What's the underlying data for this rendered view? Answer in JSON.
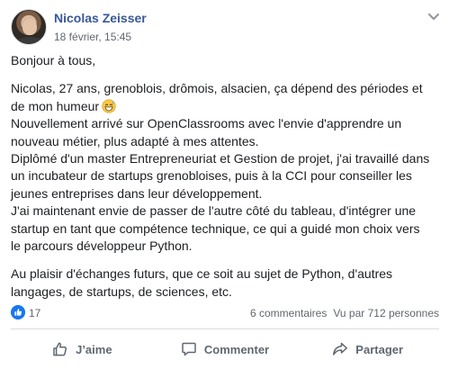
{
  "post": {
    "author": "Nicolas Zeisser",
    "timestamp": "18 février, 15:45",
    "paragraphs": [
      [
        "Bonjour à tous,"
      ],
      [
        "Nicolas, 27 ans, grenoblois, drômois, alsacien, ça dépend des périodes et",
        "de mon humeur",
        "Nouvellement arrivé sur OpenClassrooms avec l'envie d'apprendre un",
        "nouveau métier, plus adapté à mes attentes.",
        "Diplômé d'un master Entrepreneuriat et Gestion de projet, j'ai travaillé dans",
        "un incubateur de startups grenobloises, puis à la CCI pour conseiller les",
        "jeunes entreprises dans leur développement.",
        "J'ai maintenant envie de passer de l'autre côté du tableau, d'intégrer une",
        "startup en tant que compétence technique, ce qui a guidé mon choix vers",
        "le parcours développeur Python."
      ],
      [
        "Au plaisir d'échanges futurs, que ce soit au sujet de Python, d'autres",
        "langages, de startups, de sciences, etc."
      ]
    ]
  },
  "stats": {
    "likes": "17",
    "comments": "6 commentaires",
    "views": "Vu par 712 personnes"
  },
  "actions": {
    "like": "J’aime",
    "comment": "Commenter",
    "share": "Partager"
  },
  "icons": {
    "menu": "chevron-down-icon",
    "like_badge": "thumbs-up-icon",
    "emoji": "grinning-sweat-emoji-icon"
  },
  "colors": {
    "author_link": "#385898",
    "like_blue": "#1877f2",
    "secondary_text": "#606770"
  }
}
